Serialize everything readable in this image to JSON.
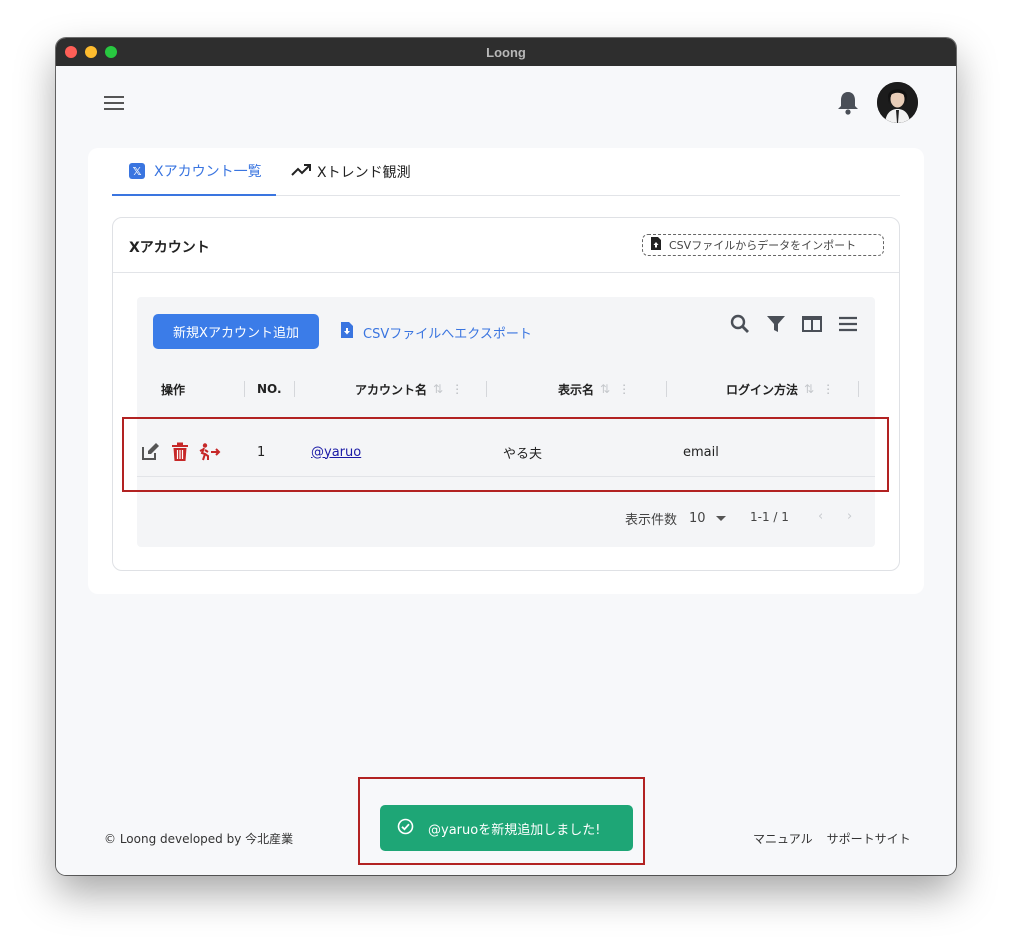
{
  "window": {
    "title": "Loong"
  },
  "header": {
    "menu_icon": "hamburger-icon",
    "notification_icon": "bell-icon",
    "avatar_alt": "user-avatar"
  },
  "tabs": [
    {
      "label": "Xアカウント一覧",
      "icon": "x-logo-icon",
      "active": true
    },
    {
      "label": "Xトレンド観測",
      "icon": "trending-up-icon",
      "active": false
    }
  ],
  "section": {
    "title": "Xアカウント",
    "import_label": "CSVファイルからデータをインポート"
  },
  "toolbar": {
    "add_label": "新規Xアカウント追加",
    "export_label": "CSVファイルへエクスポート",
    "icons": [
      "search-icon",
      "filter-icon",
      "columns-icon",
      "density-icon"
    ]
  },
  "table": {
    "columns": [
      "操作",
      "NO.",
      "アカウント名",
      "表示名",
      "ログイン方法"
    ],
    "rows": [
      {
        "no": "1",
        "account": "@yaruo",
        "display_name": "やる夫",
        "login": "email"
      }
    ],
    "row_actions": [
      "edit-icon",
      "delete-icon",
      "logout-icon"
    ]
  },
  "pagination": {
    "per_page_label": "表示件数",
    "per_page_value": "10",
    "range": "1-1 / 1",
    "prev": "‹",
    "next": "›"
  },
  "footer": {
    "copyright": "© Loong developed by 今北産業",
    "links": [
      "マニュアル",
      "サポートサイト"
    ]
  },
  "toast": {
    "message": "@yaruoを新規追加しました!"
  },
  "colors": {
    "accent": "#3a75e0",
    "danger": "#c62828",
    "success": "#1ea676",
    "highlight": "#b22222"
  }
}
